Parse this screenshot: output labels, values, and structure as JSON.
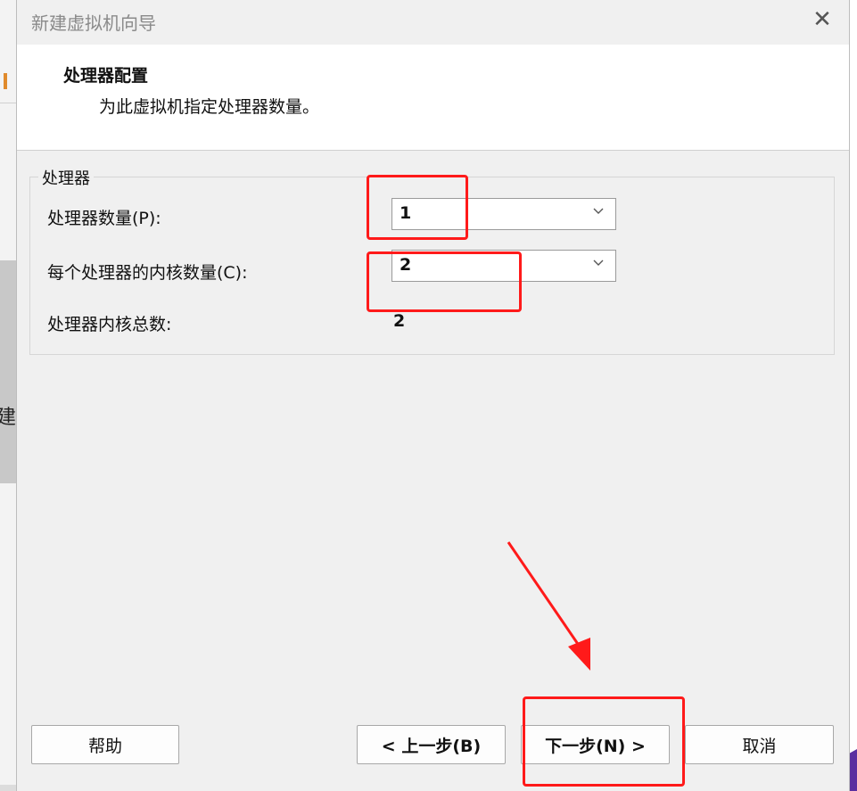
{
  "dialog": {
    "title": "新建虚拟机向导",
    "close_glyph": "✕",
    "header": {
      "title": "处理器配置",
      "subtitle": "为此虚拟机指定处理器数量。"
    },
    "group": {
      "legend": "处理器",
      "processor_count": {
        "label": "处理器数量(P):",
        "value": "1"
      },
      "cores_per_processor": {
        "label": "每个处理器的内核数量(C):",
        "value": "2"
      },
      "total_cores": {
        "label": "处理器内核总数:",
        "value": "2"
      }
    },
    "buttons": {
      "help": "帮助",
      "back": "< 上一步(B)",
      "next": "下一步(N) >",
      "cancel": "取消"
    }
  },
  "background": {
    "left_fragment_char": "建"
  },
  "colors": {
    "annotation_red": "#ff1a1a",
    "dialog_bg": "#f0f0f0",
    "header_bg": "#ffffff"
  }
}
